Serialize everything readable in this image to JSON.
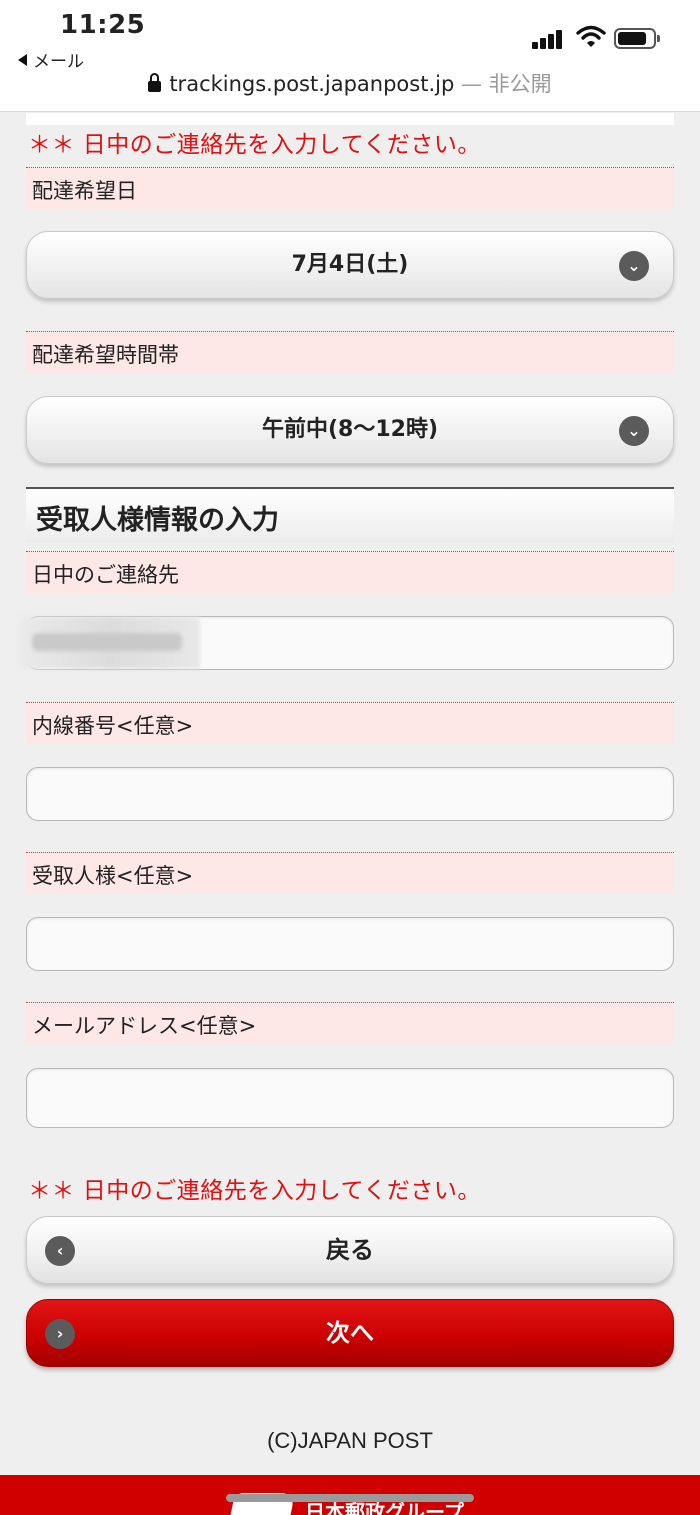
{
  "status_bar": {
    "time": "11:25",
    "back_app_label": "メール",
    "url_host": "trackings.post.japanpost.jp",
    "url_suffix": "— 非公開"
  },
  "form": {
    "warning_top": "＊＊ 日中のご連絡先を入力してください。",
    "delivery_date_label": "配達希望日",
    "delivery_date_value": "7月4日(土)",
    "delivery_time_label": "配達希望時間帯",
    "delivery_time_value": "午前中(8〜12時)",
    "section_title": "受取人様情報の入力",
    "daytime_contact_label": "日中のご連絡先",
    "daytime_contact_value": "",
    "extension_label": "内線番号<任意>",
    "extension_value": "",
    "recipient_label": "受取人様<任意>",
    "recipient_value": "",
    "email_label": "メールアドレス<任意>",
    "email_value": "",
    "warning_bottom": "＊＊ 日中のご連絡先を入力してください。"
  },
  "buttons": {
    "back_label": "戻る",
    "next_label": "次へ"
  },
  "footer": {
    "copyright": "(C)JAPAN POST",
    "group_text": "日本郵政グループ"
  },
  "icons": {
    "chevron_down": "chevron-down-icon",
    "chevron_left": "chevron-left-icon",
    "chevron_right": "chevron-right-icon"
  },
  "colors": {
    "accent_red": "#cc0000",
    "warning_text": "#e01010",
    "label_background": "#fde7e7"
  }
}
